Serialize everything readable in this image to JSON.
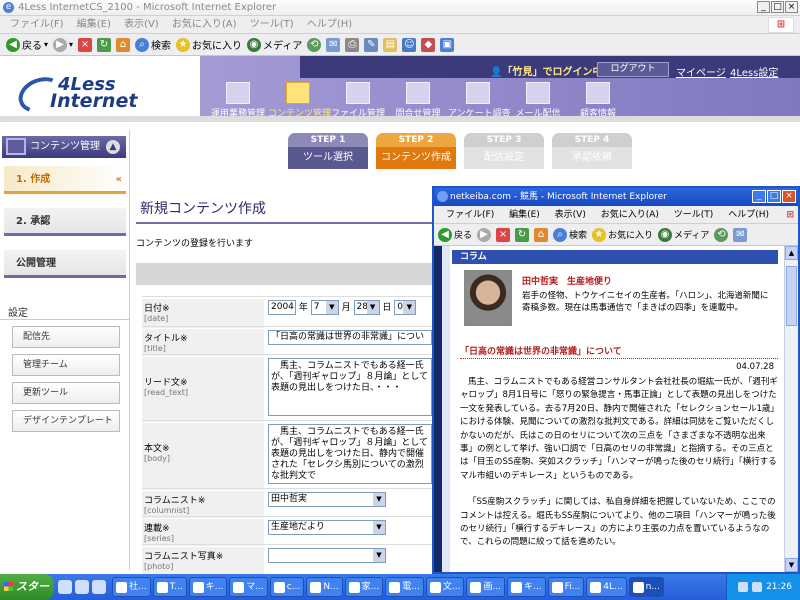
{
  "main": {
    "window_title": "4Less InternetCS_2100 - Microsoft Internet Explorer",
    "menu": [
      "ファイル(F)",
      "編集(E)",
      "表示(V)",
      "お気に入り(A)",
      "ツール(T)",
      "ヘルプ(H)"
    ],
    "toolbar": {
      "back": "戻る",
      "search": "検索",
      "favorites": "お気に入り",
      "media": "メディア"
    }
  },
  "site": {
    "logo_top": "4Less",
    "logo_bottom": "Internet",
    "login_user": "「竹見」でログイン中",
    "logout": "ログアウト",
    "my_page": "マイページ",
    "settings": "4Less設定",
    "nav": [
      "運用業務管理",
      "コンテンツ管理",
      "ファイル管理",
      "問合せ管理",
      "アンケート調査",
      "メール配信",
      "顧客情報"
    ]
  },
  "sidebar": {
    "header": "コンテンツ管理",
    "item_create": "1. 作成",
    "item_approve": "2. 承認",
    "item_publish": "公開管理",
    "settings_header": "設定",
    "sub": [
      "配信先",
      "管理チーム",
      "更新ツール",
      "デザインテンプレート"
    ]
  },
  "steps": [
    {
      "num": "STEP 1",
      "label": "ツール選択"
    },
    {
      "num": "STEP 2",
      "label": "コンテンツ作成"
    },
    {
      "num": "STEP 3",
      "label": "配信設定"
    },
    {
      "num": "STEP 4",
      "label": "承認依頼"
    }
  ],
  "page": {
    "title": "新規コンテンツ作成",
    "desc": "コンテンツの登録を行います"
  },
  "form": {
    "date": {
      "label": "日付※",
      "key": "[date]",
      "year": "2004",
      "year_unit": "年",
      "month": "7",
      "month_unit": "月",
      "day": "28",
      "day_unit": "日",
      "hour": "0"
    },
    "title": {
      "label": "タイトル※",
      "key": "[title]",
      "value": "「日高の常識は世界の非常識」につい"
    },
    "lead": {
      "label": "リード文※",
      "key": "[read_text]",
      "value": "　馬主、コラムニストでもある経一氏が、「週刊ギャロップ」８月論」として表題の見出しをつけた日、・・・"
    },
    "body": {
      "label": "本文※",
      "key": "[body]",
      "value": "　馬主、コラムニストでもある経一氏が、「週刊ギャロップ」８月論」として表題の見出しをつけた日、静内で開催された「セレクシ馬別についての激烈な批判文で"
    },
    "columnist": {
      "label": "コラムニスト※",
      "key": "[columnist]",
      "value": "田中哲実"
    },
    "series": {
      "label": "連載※",
      "key": "[series]",
      "value": "生産地だより"
    },
    "photo": {
      "label": "コラムニスト写真※",
      "key": "[photo]"
    }
  },
  "popup": {
    "window_title": "netkeiba.com - 競馬 - Microsoft Internet Explorer",
    "menu": [
      "ファイル(F)",
      "編集(E)",
      "表示(V)",
      "お気に入り(A)",
      "ツール(T)",
      "ヘルプ(H)"
    ],
    "toolbar": {
      "back": "戻る",
      "search": "検索",
      "favorites": "お気に入り",
      "media": "メディア"
    },
    "section": "コラム",
    "author": "田中哲実　生産地便り",
    "author_desc": "岩手の怪物、トウケイニセイの生産者。「ハロン」、北海道新聞に寄稿多数。現在は馬事通信で「まきばの四季」を連載中。",
    "article_title": "「日高の常識は世界の非常識」について",
    "article_date": "04.07.28",
    "para1": "馬主、コラムニストでもある経営コンサルタント会社社長の堀紘一氏が、「週刊ギャロップ」8月1日号に「怒りの緊急提言・馬事正論」として表題の見出しをつけた一文を発表している。去る7月20日、静内で開催された「セレクションセール1歳」における体験、見聞についての激烈な批判文である。詳細は同誌をご覧いただくしかないのだが、氏はこの日のセリについて次の三点を「さまざまな不透明な出来事」の例として挙げ、強い口調で「日高のセリの非常識」と指摘する。その三点とは「目玉のSS産駒、突如スクラッチ」「ハンマーが鳴った後のセリ続行」「横行するマル市組いのデキレース」というものである。",
    "para2": "「SS産駒スクラッチ」に関しては、私自身詳細を把握していないため、ここでのコメントは控える。堀氏もSS産駒についてより、他の二項目「ハンマーが鳴った後のセリ続行」「横行するデキレース」の方により主張の力点を置いているようなので、これらの問題に絞って話を進めたい。"
  },
  "taskbar": {
    "start": "スタート",
    "tasks": [
      "社...",
      "T...",
      "キ...",
      "マ...",
      "c...",
      "N...",
      "家...",
      "電...",
      "文...",
      "画...",
      "キ...",
      "Fi...",
      "4L...",
      "n..."
    ],
    "clock": "21:26"
  }
}
